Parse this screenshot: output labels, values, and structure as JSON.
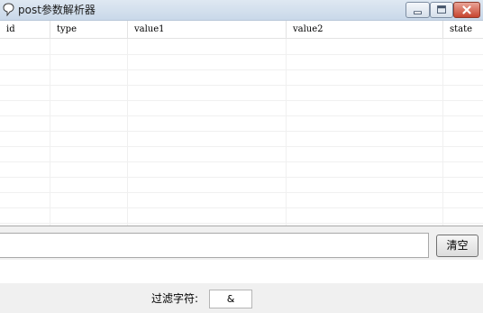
{
  "window": {
    "title": "post参数解析器"
  },
  "table": {
    "columns": [
      "id",
      "type",
      "value1",
      "value2",
      "state"
    ],
    "rows": []
  },
  "input": {
    "value": ""
  },
  "clear_button": {
    "label": "清空"
  },
  "output": {
    "value": ""
  },
  "filter": {
    "label": "过滤字符:",
    "value": "&"
  }
}
